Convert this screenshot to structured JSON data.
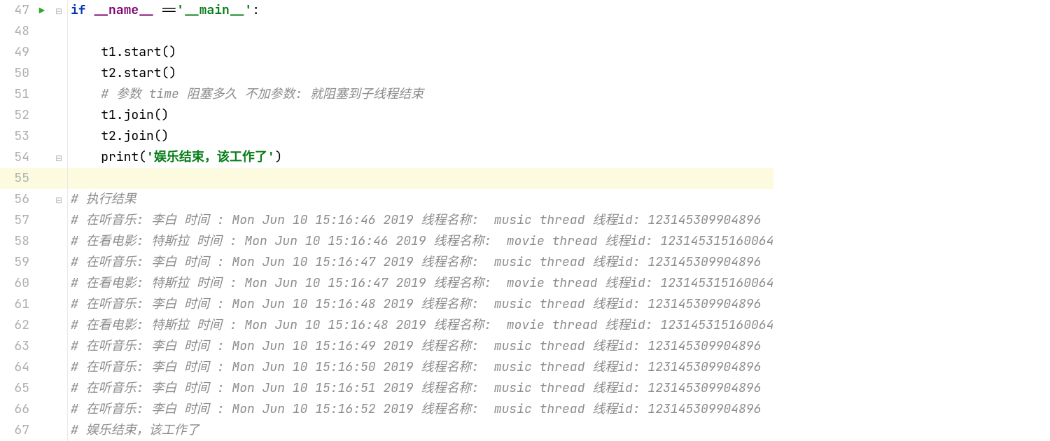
{
  "lines": [
    {
      "num": "47",
      "run": true,
      "fold": "▾",
      "segments": [
        {
          "indent": 0
        },
        {
          "t": "if ",
          "cls": "kw"
        },
        {
          "t": "__name__",
          "cls": "magic"
        },
        {
          "t": " ==",
          "cls": ""
        },
        {
          "t": "'__main__'",
          "cls": "str"
        },
        {
          "t": ":",
          "cls": ""
        }
      ]
    },
    {
      "num": "48",
      "run": false,
      "fold": "",
      "segments": [
        {
          "indent": 0
        }
      ]
    },
    {
      "num": "49",
      "run": false,
      "fold": "",
      "segments": [
        {
          "indent": 1
        },
        {
          "t": "t1.start()",
          "cls": ""
        }
      ]
    },
    {
      "num": "50",
      "run": false,
      "fold": "",
      "segments": [
        {
          "indent": 1
        },
        {
          "t": "t2.start()",
          "cls": ""
        }
      ]
    },
    {
      "num": "51",
      "run": false,
      "fold": "",
      "segments": [
        {
          "indent": 1
        },
        {
          "t": "# 参数 time 阻塞多久 不加参数: 就阻塞到子线程结束",
          "cls": "cmt"
        }
      ]
    },
    {
      "num": "52",
      "run": false,
      "fold": "",
      "segments": [
        {
          "indent": 1
        },
        {
          "t": "t1.join()",
          "cls": ""
        }
      ]
    },
    {
      "num": "53",
      "run": false,
      "fold": "",
      "segments": [
        {
          "indent": 1
        },
        {
          "t": "t2.join()",
          "cls": ""
        }
      ]
    },
    {
      "num": "54",
      "run": false,
      "fold": "▾",
      "segments": [
        {
          "indent": 1
        },
        {
          "t": "print",
          "cls": "fn"
        },
        {
          "t": "(",
          "cls": ""
        },
        {
          "t": "'娱乐结束，该工作了'",
          "cls": "str"
        },
        {
          "t": ")",
          "cls": ""
        }
      ]
    },
    {
      "num": "55",
      "run": false,
      "fold": "",
      "highlight": true,
      "segments": [
        {
          "indent": 0
        }
      ]
    },
    {
      "num": "56",
      "run": false,
      "fold": "▾",
      "segments": [
        {
          "indent": 0
        },
        {
          "t": "# 执行结果",
          "cls": "cmt"
        }
      ]
    },
    {
      "num": "57",
      "run": false,
      "fold": "",
      "segments": [
        {
          "indent": 0
        },
        {
          "t": "# 在听音乐: 李白 时间 : Mon Jun 10 15:16:46 2019 线程名称:  music thread 线程id: 123145309904896",
          "cls": "cmt"
        }
      ]
    },
    {
      "num": "58",
      "run": false,
      "fold": "",
      "segments": [
        {
          "indent": 0
        },
        {
          "t": "# 在看电影: 特斯拉 时间 : Mon Jun 10 15:16:46 2019 线程名称:  movie thread 线程id: 123145315160064",
          "cls": "cmt"
        }
      ]
    },
    {
      "num": "59",
      "run": false,
      "fold": "",
      "segments": [
        {
          "indent": 0
        },
        {
          "t": "# 在听音乐: 李白 时间 : Mon Jun 10 15:16:47 2019 线程名称:  music thread 线程id: 123145309904896",
          "cls": "cmt"
        }
      ]
    },
    {
      "num": "60",
      "run": false,
      "fold": "",
      "segments": [
        {
          "indent": 0
        },
        {
          "t": "# 在看电影: 特斯拉 时间 : Mon Jun 10 15:16:47 2019 线程名称:  movie thread 线程id: 123145315160064",
          "cls": "cmt"
        }
      ]
    },
    {
      "num": "61",
      "run": false,
      "fold": "",
      "segments": [
        {
          "indent": 0
        },
        {
          "t": "# 在听音乐: 李白 时间 : Mon Jun 10 15:16:48 2019 线程名称:  music thread 线程id: 123145309904896",
          "cls": "cmt"
        }
      ]
    },
    {
      "num": "62",
      "run": false,
      "fold": "",
      "segments": [
        {
          "indent": 0
        },
        {
          "t": "# 在看电影: 特斯拉 时间 : Mon Jun 10 15:16:48 2019 线程名称:  movie thread 线程id: 123145315160064",
          "cls": "cmt"
        }
      ]
    },
    {
      "num": "63",
      "run": false,
      "fold": "",
      "segments": [
        {
          "indent": 0
        },
        {
          "t": "# 在听音乐: 李白 时间 : Mon Jun 10 15:16:49 2019 线程名称:  music thread 线程id: 123145309904896",
          "cls": "cmt"
        }
      ]
    },
    {
      "num": "64",
      "run": false,
      "fold": "",
      "segments": [
        {
          "indent": 0
        },
        {
          "t": "# 在听音乐: 李白 时间 : Mon Jun 10 15:16:50 2019 线程名称:  music thread 线程id: 123145309904896",
          "cls": "cmt"
        }
      ]
    },
    {
      "num": "65",
      "run": false,
      "fold": "",
      "segments": [
        {
          "indent": 0
        },
        {
          "t": "# 在听音乐: 李白 时间 : Mon Jun 10 15:16:51 2019 线程名称:  music thread 线程id: 123145309904896",
          "cls": "cmt"
        }
      ]
    },
    {
      "num": "66",
      "run": false,
      "fold": "",
      "segments": [
        {
          "indent": 0
        },
        {
          "t": "# 在听音乐: 李白 时间 : Mon Jun 10 15:16:52 2019 线程名称:  music thread 线程id: 123145309904896",
          "cls": "cmt"
        }
      ]
    },
    {
      "num": "67",
      "run": false,
      "fold": "",
      "segments": [
        {
          "indent": 0
        },
        {
          "t": "# 娱乐结束，该工作了",
          "cls": "cmt"
        }
      ]
    }
  ],
  "indent_unit": "    "
}
